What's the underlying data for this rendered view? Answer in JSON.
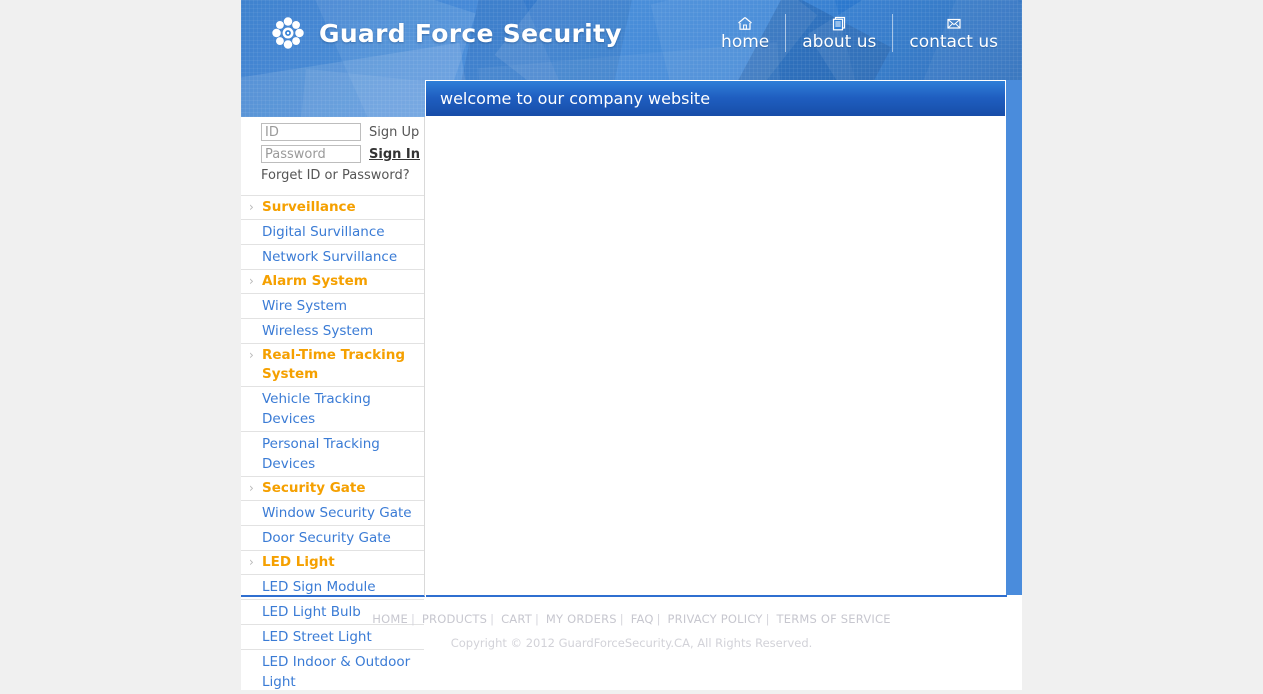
{
  "site": {
    "brand": "Guard Force Security",
    "logo_icon": "flower-asterisk-icon"
  },
  "topnav": [
    {
      "label": "home",
      "icon": "house-icon"
    },
    {
      "label": "about us",
      "icon": "documents-icon"
    },
    {
      "label": "contact us",
      "icon": "envelope-icon"
    }
  ],
  "banner": {
    "title": "welcome to our company website"
  },
  "login": {
    "id_placeholder": "ID",
    "id_value": "",
    "password_placeholder": "Password",
    "password_value": "",
    "signup_label": "Sign Up",
    "signin_label": "Sign In",
    "forgot_label": "Forget ID or Password?"
  },
  "menu": [
    {
      "type": "category",
      "label": "Surveillance",
      "chevron": "›"
    },
    {
      "type": "sub",
      "label": "Digital Survillance"
    },
    {
      "type": "sub",
      "label": "Network Survillance"
    },
    {
      "type": "category",
      "label": "Alarm System",
      "chevron": "›"
    },
    {
      "type": "sub",
      "label": "Wire System"
    },
    {
      "type": "sub",
      "label": "Wireless System"
    },
    {
      "type": "category",
      "label": "Real-Time Tracking System",
      "chevron": "›"
    },
    {
      "type": "sub",
      "label": "Vehicle Tracking Devices"
    },
    {
      "type": "sub",
      "label": "Personal Tracking Devices"
    },
    {
      "type": "category",
      "label": "Security Gate",
      "chevron": "›"
    },
    {
      "type": "sub",
      "label": "Window Security Gate"
    },
    {
      "type": "sub",
      "label": "Door Security Gate"
    },
    {
      "type": "category",
      "label": "LED Light",
      "chevron": "›"
    },
    {
      "type": "sub",
      "label": "LED Sign Module"
    },
    {
      "type": "sub",
      "label": "LED Light Bulb"
    },
    {
      "type": "sub",
      "label": "LED Street Light"
    },
    {
      "type": "sub",
      "label": "LED Indoor & Outdoor Light"
    }
  ],
  "footer": {
    "links": [
      "HOME",
      "PRODUCTS",
      "CART",
      "MY ORDERS",
      "FAQ",
      "PRIVACY POLICY",
      "TERMS OF SERVICE"
    ],
    "separator": "|",
    "copyright": "Copyright © 2012 GuardForceSecurity.CA, All Rights Reserved."
  },
  "colors": {
    "brand_blue": "#2f7fd6",
    "banner_blue": "#1f5ec0",
    "accent_orange": "#f5a000",
    "link_blue": "#3a7bd5",
    "page_bg": "#f0f0f0",
    "rail_blue": "#4a8cdc"
  }
}
